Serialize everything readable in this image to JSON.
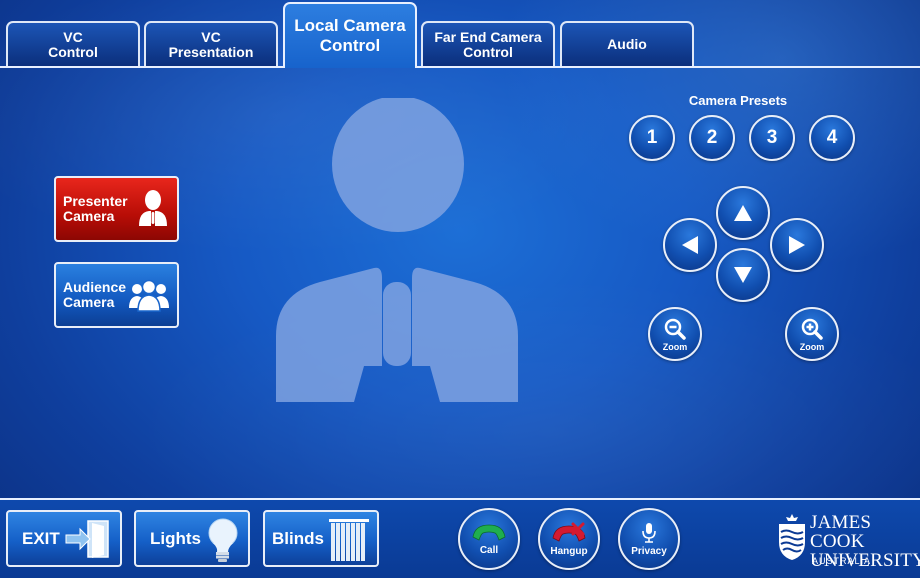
{
  "tabs": [
    {
      "label": "VC\nControl",
      "active": false
    },
    {
      "label": "VC\nPresentation",
      "active": false
    },
    {
      "label": "Local Camera\nControl",
      "active": true
    },
    {
      "label": "Far End Camera\nControl",
      "active": false
    },
    {
      "label": "Audio",
      "active": false
    }
  ],
  "cameras": {
    "presenter": {
      "label": "Presenter\nCamera",
      "icon": "presenter-icon",
      "color": "#d0150c"
    },
    "audience": {
      "label": "Audience\nCamera",
      "icon": "audience-icon",
      "color": "#1a66cc"
    }
  },
  "presets": {
    "title": "Camera Presets",
    "items": [
      "1",
      "2",
      "3",
      "4"
    ]
  },
  "ptz": {
    "up_icon": "arrow-up-icon",
    "down_icon": "arrow-down-icon",
    "left_icon": "arrow-left-icon",
    "right_icon": "arrow-right-icon",
    "zoom_out_label": "Zoom",
    "zoom_in_label": "Zoom"
  },
  "bottom": {
    "exit_label": "EXIT",
    "lights_label": "Lights",
    "blinds_label": "Blinds",
    "call_label": "Call",
    "hangup_label": "Hangup",
    "privacy_label": "Privacy"
  },
  "logo": {
    "name": "JAMES COOK\nUNIVERSITY",
    "country": "AUSTRALIA"
  },
  "colors": {
    "background": "#1659c4",
    "call": "#1aa64a",
    "hangup": "#c8152a"
  }
}
